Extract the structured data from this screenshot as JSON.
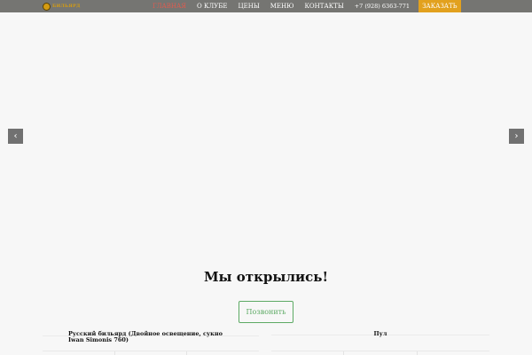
{
  "header": {
    "logo_text": "БИЛЬЯРД",
    "nav": [
      {
        "label": "ГЛАВНАЯ",
        "active": true
      },
      {
        "label": "О КЛУБЕ",
        "active": false
      },
      {
        "label": "ЦЕНЫ",
        "active": false
      },
      {
        "label": "МЕНЮ",
        "active": false
      },
      {
        "label": "КОНТАКТЫ",
        "active": false
      }
    ],
    "phone": "+7 (928) 6363-771",
    "order_label": "ЗАКАЗАТЬ",
    "colors": {
      "bar": "#757572",
      "active": "#e05b4f",
      "order": "#e2a11e"
    }
  },
  "slider": {
    "prev_icon": "chevron-left-icon",
    "next_icon": "chevron-right-icon",
    "prev_glyph": "‹",
    "next_glyph": "›"
  },
  "hero": {
    "title": "Мы открылись!",
    "call_label": "Позвонить",
    "accent": "#5daa64"
  },
  "tables": [
    {
      "title": "Русский бильярд (Двойное освещение, сукно Iwan Simonis 760)"
    },
    {
      "title": "Пул"
    }
  ]
}
